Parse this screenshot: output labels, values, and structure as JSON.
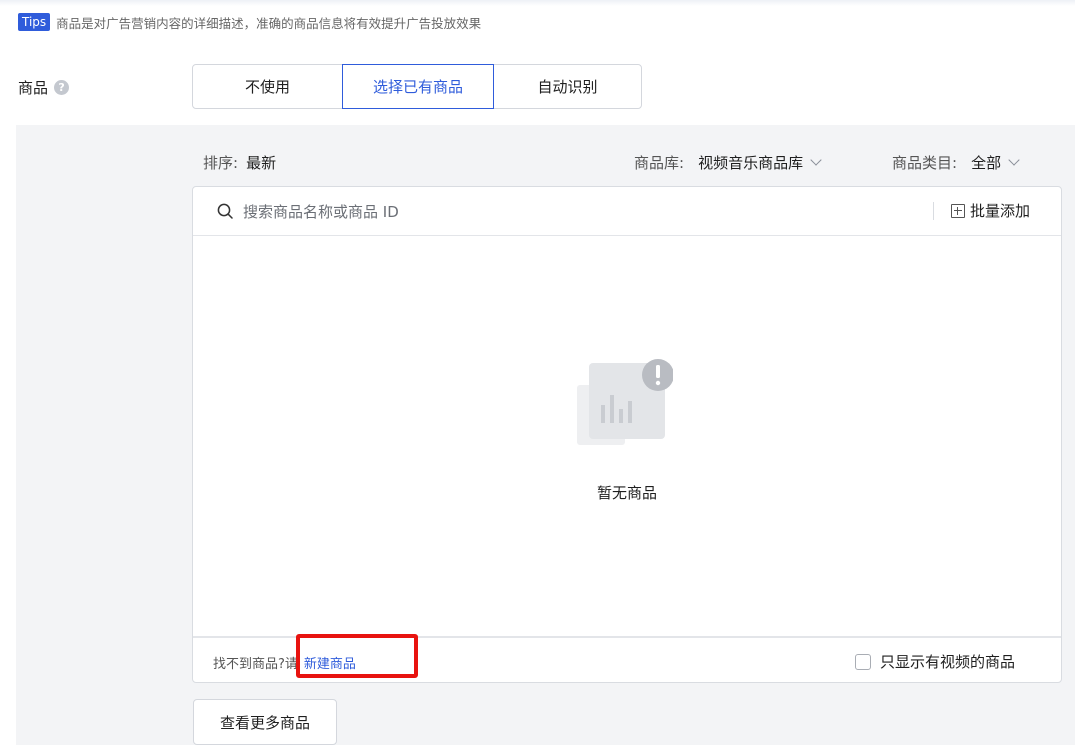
{
  "tips": {
    "badge": "Tips",
    "text": "商品是对广告营销内容的详细描述，准确的商品信息将有效提升广告投放效果"
  },
  "field": {
    "label": "商品",
    "help_icon": "question-circle-icon"
  },
  "mode_tabs": [
    {
      "label": "不使用",
      "selected": false
    },
    {
      "label": "选择已有商品",
      "selected": true
    },
    {
      "label": "自动识别",
      "selected": false
    }
  ],
  "filters": {
    "sort_label": "排序:",
    "sort_value": "最新",
    "library_label": "商品库:",
    "library_value": "视频音乐商品库",
    "category_label": "商品类目:",
    "category_value": "全部"
  },
  "search": {
    "placeholder": "搜索商品名称或商品 ID",
    "icon": "search-icon",
    "batch_label": "批量添加",
    "batch_icon": "plus-square-icon"
  },
  "empty": {
    "icon": "empty-chart-alert-icon",
    "text": "暂无商品"
  },
  "footer": {
    "not_found_text": "找不到商品?",
    "please_text": "请",
    "new_link": "新建商品",
    "only_video_label": "只显示有视频的商品",
    "only_video_checked": false
  },
  "more_button": "查看更多商品",
  "colors": {
    "accent": "#2f5cdb",
    "highlight": "#e8130f",
    "panel_bg": "#f3f4f6"
  }
}
